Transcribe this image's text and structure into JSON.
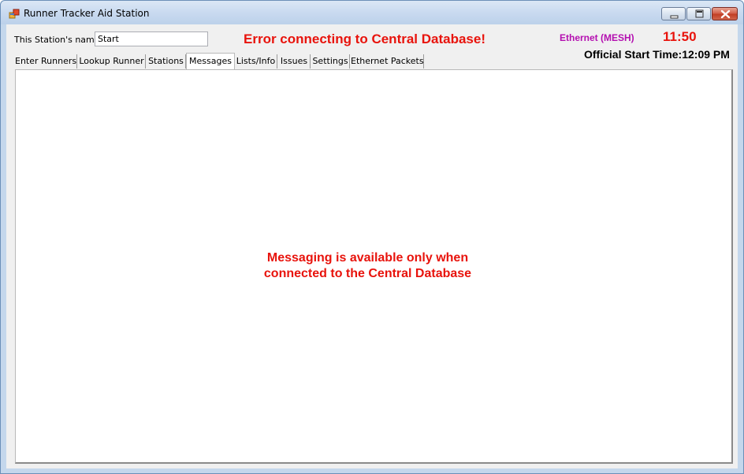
{
  "window": {
    "title": "Runner Tracker Aid Station",
    "app_icon": "app-window-icon",
    "controls": [
      "minimize-icon",
      "maximize-icon",
      "close-icon"
    ]
  },
  "header": {
    "station_name_label": "This Station's name:",
    "station_name_value": "Start",
    "error_text": "Error connecting to Central Database!",
    "connection_text": "Ethernet (MESH)",
    "clock": "11:50",
    "official_start_time": "Official Start Time:12:09 PM"
  },
  "tabs": [
    {
      "label": "Enter Runners"
    },
    {
      "label": "Lookup Runner"
    },
    {
      "label": "Stations"
    },
    {
      "label": "Messages"
    },
    {
      "label": "Lists/Info"
    },
    {
      "label": "Issues"
    },
    {
      "label": "Settings"
    },
    {
      "label": "Ethernet Packets"
    }
  ],
  "active_tab": "Messages",
  "messages_page": {
    "line1": "Messaging is available only when",
    "line2": "connected to the Central Database"
  },
  "colors": {
    "error_red": "#e8130c",
    "connection_magenta": "#b40fb0",
    "window_frame": "#c4d7ec"
  }
}
